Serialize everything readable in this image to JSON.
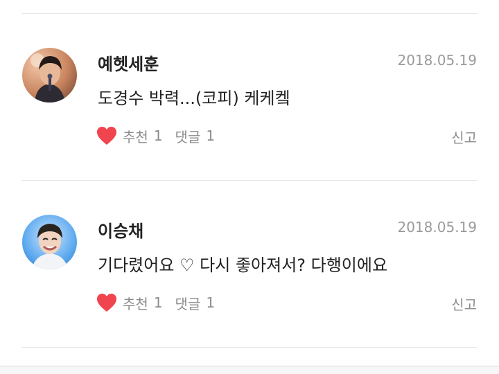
{
  "comments": [
    {
      "author": "예헷세훈",
      "date": "2018.05.19",
      "text": "도경수 박력...(코피) 케케켘",
      "like_label": "추천",
      "like_count": "1",
      "reply_label": "댓글",
      "reply_count": "1",
      "report_label": "신고",
      "avatar_icon": "user-avatar-photo",
      "like_icon": "heart-icon"
    },
    {
      "author": "이승채",
      "date": "2018.05.19",
      "text": "기다렸어요 ♡ 다시 좋아져서? 다행이에요",
      "like_label": "추천",
      "like_count": "1",
      "reply_label": "댓글",
      "reply_count": "1",
      "report_label": "신고",
      "avatar_icon": "user-avatar-photo",
      "like_icon": "heart-icon"
    }
  ],
  "colors": {
    "heart": "#f0444e",
    "text": "#222222",
    "meta": "#8c8c8c",
    "date": "#9a9a9a",
    "divider": "#e6e6e6"
  }
}
